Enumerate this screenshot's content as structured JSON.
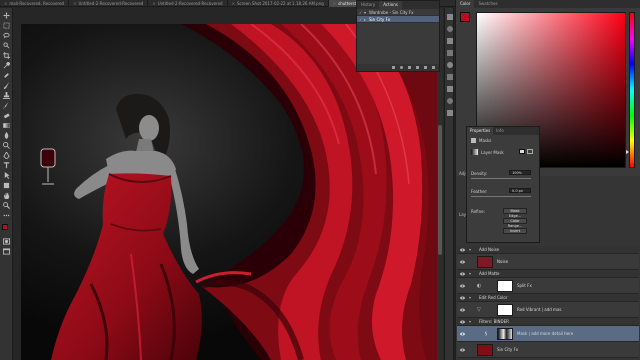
{
  "tabs": [
    {
      "label": "mali-Recovered, Recovered",
      "active": false
    },
    {
      "label": "Untitled-2-Recovered-Recovered",
      "active": false
    },
    {
      "label": "Untitled-2-Recovered-Recovered",
      "active": false
    },
    {
      "label": "Screen Shot 2017-02-22 at 1.18.26 AM.png",
      "active": false
    },
    {
      "label": "shutterstock_423493733.jpg @ 50% (Mask) ...",
      "active": true
    }
  ],
  "actions_panel": {
    "tabs": [
      "History",
      "Actions"
    ],
    "active_tab": "Actions",
    "rows": [
      {
        "label": "Wardrobe - Sin City Fx",
        "selected": false
      },
      {
        "label": "Sin City Fx",
        "selected": true
      }
    ]
  },
  "color_panel": {
    "tabs": [
      "Color",
      "Swatches"
    ],
    "active_tab": "Color",
    "foreground": "#b80d22",
    "background": "#ffffff"
  },
  "properties_panel": {
    "tabs": [
      "Properties",
      "Info"
    ],
    "active_tab": "Properties",
    "section": "Masks",
    "mask_type": "Layer Mask",
    "density_label": "Density:",
    "density_value": "100%",
    "feather_label": "Feather:",
    "feather_value": "0.0 px",
    "refine_label": "Refine:",
    "mask_edge_button": "Mask Edge...",
    "color_range_button": "Color Range...",
    "invert_button": "Invert"
  },
  "lower_panel": {
    "adjust_label": "Adju",
    "layers_label": "Laye"
  },
  "layers": [
    {
      "kind": "group",
      "name": "Add Noise"
    },
    {
      "kind": "layer",
      "name": "Noise",
      "thumb": "#7a1a22"
    },
    {
      "kind": "group",
      "name": "Add Matte"
    },
    {
      "kind": "layer",
      "name": "Split Fx",
      "thumb": "#ffffff"
    },
    {
      "kind": "group",
      "name": "Edit Red Color"
    },
    {
      "kind": "layer",
      "name": "Red Vibrant | add mas",
      "thumb": "#ffffff"
    },
    {
      "kind": "group",
      "name": "Filters: BINDER"
    },
    {
      "kind": "layer",
      "name": "Mask | add more detail here",
      "thumb": "#dddddd",
      "selected": true
    },
    {
      "kind": "layer",
      "name": "Sin City Fx",
      "thumb": "#7d1016"
    }
  ],
  "accent": "#5a6b86"
}
